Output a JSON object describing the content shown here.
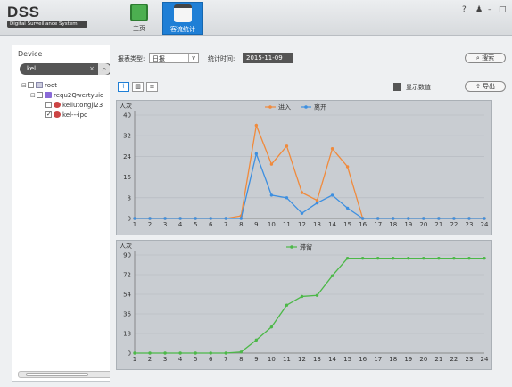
{
  "app": {
    "title": "DSS",
    "subtitle": "Digital Surveillance System"
  },
  "nav": {
    "tabs": [
      {
        "label": "主页"
      },
      {
        "label": "客流统计"
      }
    ]
  },
  "window_controls": {
    "help": "?",
    "user": "♟",
    "minimize": "–",
    "maximize": "□"
  },
  "device_panel": {
    "header": "Device",
    "search": {
      "value": "kel",
      "clear": "×"
    },
    "tree": [
      {
        "expand": "⊟",
        "checked": false,
        "icon": "root-icon",
        "label": "root"
      },
      {
        "expand": "⊟",
        "checked": false,
        "icon": "device-icon",
        "label": "requ2Qwertyuio"
      },
      {
        "expand": "",
        "checked": false,
        "icon": "camera-icon",
        "label": "keliutongji23"
      },
      {
        "expand": "",
        "checked": true,
        "icon": "camera-icon",
        "label": "kel---ipc"
      }
    ]
  },
  "filters": {
    "report_type_label": "报表类型:",
    "report_type_value": "日报",
    "time_label": "统计时间:",
    "time_value": "2015-11-09",
    "search_button": "搜索"
  },
  "toolbar": {
    "show_values_label": "显示数值",
    "export_button": "导出"
  },
  "chart_data": [
    {
      "type": "line",
      "ylabel": "人次",
      "ylim": [
        0,
        40
      ],
      "yticks": [
        0,
        8,
        16,
        24,
        32,
        40
      ],
      "x": [
        1,
        2,
        3,
        4,
        5,
        6,
        7,
        8,
        9,
        10,
        11,
        12,
        13,
        14,
        15,
        16,
        17,
        18,
        19,
        20,
        21,
        22,
        23,
        24
      ],
      "series": [
        {
          "name": "进入",
          "color": "#f08a3c",
          "values": [
            0,
            0,
            0,
            0,
            0,
            0,
            0,
            1,
            36,
            21,
            28,
            10,
            7,
            27,
            20,
            0,
            0,
            0,
            0,
            0,
            0,
            0,
            0,
            0
          ]
        },
        {
          "name": "离开",
          "color": "#3d8fe0",
          "values": [
            0,
            0,
            0,
            0,
            0,
            0,
            0,
            0,
            25,
            9,
            8,
            2,
            6,
            9,
            4,
            0,
            0,
            0,
            0,
            0,
            0,
            0,
            0,
            0
          ]
        }
      ]
    },
    {
      "type": "line",
      "ylabel": "人次",
      "ylim": [
        0,
        90
      ],
      "yticks": [
        0,
        18,
        36,
        54,
        72,
        90
      ],
      "x": [
        1,
        2,
        3,
        4,
        5,
        6,
        7,
        8,
        9,
        10,
        11,
        12,
        13,
        14,
        15,
        16,
        17,
        18,
        19,
        20,
        21,
        22,
        23,
        24
      ],
      "series": [
        {
          "name": "滞留",
          "color": "#4cb848",
          "values": [
            0,
            0,
            0,
            0,
            0,
            0,
            0,
            1,
            12,
            24,
            44,
            52,
            53,
            71,
            87,
            87,
            87,
            87,
            87,
            87,
            87,
            87,
            87,
            87
          ]
        }
      ]
    }
  ]
}
